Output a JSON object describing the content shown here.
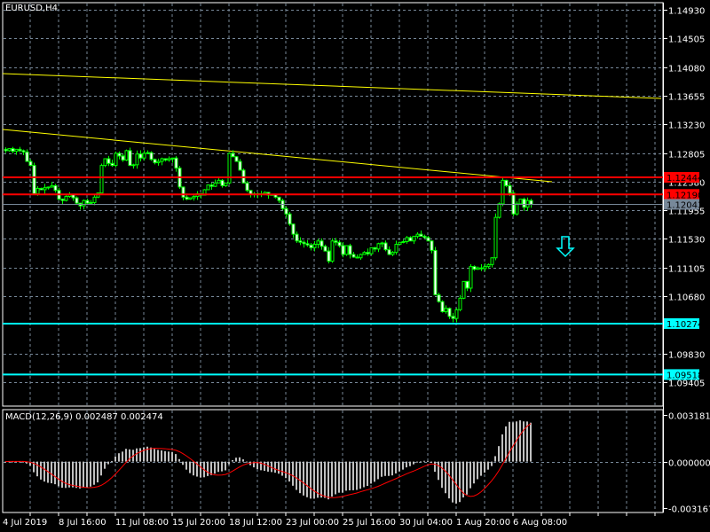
{
  "symbol_title": "EURUSD,H4",
  "colors": {
    "background": "#000000",
    "grid": "#778899",
    "bull_candle": "#00ff00",
    "bear_body": "#ffffff",
    "trendline": "#ffff00",
    "resistance": "#ff0000",
    "support": "#00ffff",
    "bid_line": "#778899",
    "macd_histogram": "#c0c0c0",
    "macd_signal": "#ff0000",
    "axis": "#ffffff"
  },
  "price_axis": {
    "ticks": [
      "1.14930",
      "1.14505",
      "1.14080",
      "1.13655",
      "1.13230",
      "1.12805",
      "1.12380",
      "1.11955",
      "1.11530",
      "1.11105",
      "1.10680",
      "1.09830",
      "1.09405"
    ],
    "range": [
      1.09405,
      1.1493
    ]
  },
  "horizontal_lines": [
    {
      "price": "1.12444",
      "type": "resistance"
    },
    {
      "price": "1.12190",
      "type": "resistance"
    },
    {
      "price": "1.10274",
      "type": "support"
    },
    {
      "price": "1.09518",
      "type": "support"
    }
  ],
  "bid": {
    "price": "1.12043"
  },
  "trendlines": [
    {
      "from_price": 1.13983,
      "to_price": 1.13615
    },
    {
      "from_price": 1.13154,
      "to_price": 1.12378
    }
  ],
  "signal_arrow": {
    "icon": "arrow-down-icon",
    "color": "#00ffff"
  },
  "time_axis": {
    "labels": [
      "4 Jul 2019",
      "8 Jul 16:00",
      "11 Jul 08:00",
      "15 Jul 20:00",
      "18 Jul 12:00",
      "23 Jul 00:00",
      "25 Jul 16:00",
      "30 Jul 04:00",
      "1 Aug 20:00",
      "6 Aug 08:00"
    ]
  },
  "closes": [
    1.1284,
    1.1287,
    1.1283,
    1.1286,
    1.1284,
    1.1282,
    1.1268,
    1.1262,
    1.122,
    1.1228,
    1.1226,
    1.1229,
    1.123,
    1.1232,
    1.1225,
    1.1212,
    1.121,
    1.1216,
    1.1219,
    1.1214,
    1.1206,
    1.1202,
    1.121,
    1.1206,
    1.1207,
    1.1215,
    1.1221,
    1.1262,
    1.1272,
    1.1265,
    1.1262,
    1.128,
    1.1276,
    1.127,
    1.1284,
    1.1262,
    1.1263,
    1.1279,
    1.1273,
    1.128,
    1.1281,
    1.1271,
    1.1266,
    1.1268,
    1.1272,
    1.127,
    1.1272,
    1.1273,
    1.1258,
    1.123,
    1.1215,
    1.1212,
    1.1214,
    1.1216,
    1.122,
    1.1218,
    1.1226,
    1.1233,
    1.1231,
    1.1236,
    1.124,
    1.1232,
    1.1236,
    1.128,
    1.1275,
    1.1268,
    1.1255,
    1.1236,
    1.1225,
    1.1219,
    1.122,
    1.1219,
    1.122,
    1.1222,
    1.1218,
    1.1219,
    1.1215,
    1.121,
    1.1198,
    1.119,
    1.1175,
    1.116,
    1.115,
    1.1148,
    1.1146,
    1.1144,
    1.114,
    1.1145,
    1.115,
    1.1142,
    1.1135,
    1.112,
    1.115,
    1.1148,
    1.1143,
    1.113,
    1.1143,
    1.113,
    1.1126,
    1.1125,
    1.113,
    1.1133,
    1.1131,
    1.114,
    1.1138,
    1.1146,
    1.1147,
    1.1137,
    1.113,
    1.1133,
    1.1145,
    1.1148,
    1.1149,
    1.1155,
    1.115,
    1.1157,
    1.116,
    1.1157,
    1.1155,
    1.115,
    1.1136,
    1.107,
    1.106,
    1.1045,
    1.105,
    1.1038,
    1.1035,
    1.1048,
    1.1065,
    1.109,
    1.108,
    1.1112,
    1.1108,
    1.111,
    1.1109,
    1.1112,
    1.1115,
    1.1125,
    1.1185,
    1.1205,
    1.124,
    1.1232,
    1.1221,
    1.119,
    1.1205,
    1.1212,
    1.12,
    1.121,
    1.12043
  ],
  "macd": {
    "label": "MACD(12,26,9) 0.002487 0.002474",
    "ticks": [
      "0.003181",
      "0.000000",
      "-0.003167"
    ],
    "range": [
      -0.003167,
      0.003181
    ]
  }
}
